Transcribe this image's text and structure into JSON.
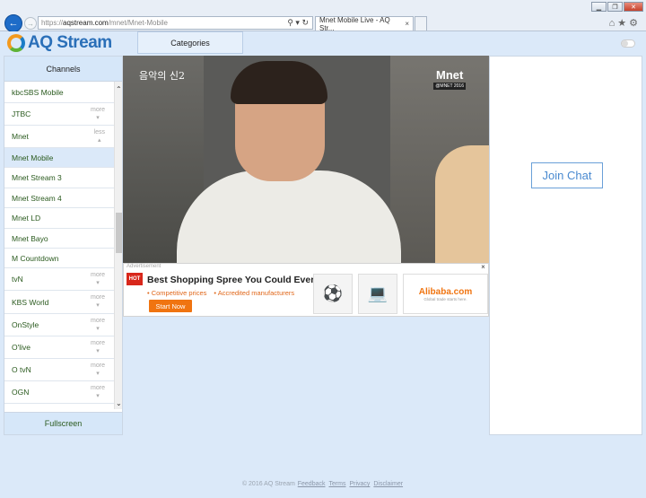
{
  "browser": {
    "url_prefix": "https://",
    "url_domain": "aqstream.com",
    "url_path": "/mnet/Mnet-Mobile",
    "tab_title": "Mnet Mobile Live - AQ Str...",
    "tab_close": "×"
  },
  "header": {
    "logo_text": "AQ Stream",
    "categories_label": "Categories"
  },
  "sidebar": {
    "title": "Channels",
    "fullscreen_label": "Fullscreen",
    "channels": [
      {
        "label": "kbcSBS Mobile",
        "toggle": "",
        "selected": false
      },
      {
        "label": "JTBC",
        "toggle": "more",
        "selected": false
      },
      {
        "label": "Mnet",
        "toggle": "less",
        "selected": false
      },
      {
        "label": "Mnet Mobile",
        "toggle": "",
        "selected": true
      },
      {
        "label": "Mnet Stream 3",
        "toggle": "",
        "selected": false
      },
      {
        "label": "Mnet Stream 4",
        "toggle": "",
        "selected": false
      },
      {
        "label": "Mnet LD",
        "toggle": "",
        "selected": false
      },
      {
        "label": "Mnet Bayo",
        "toggle": "",
        "selected": false
      },
      {
        "label": "M Countdown",
        "toggle": "",
        "selected": false
      },
      {
        "label": "tvN",
        "toggle": "more",
        "selected": false
      },
      {
        "label": "KBS World",
        "toggle": "more",
        "selected": false
      },
      {
        "label": "OnStyle",
        "toggle": "more",
        "selected": false
      },
      {
        "label": "O'live",
        "toggle": "more",
        "selected": false
      },
      {
        "label": "O tvN",
        "toggle": "more",
        "selected": false
      },
      {
        "label": "OGN",
        "toggle": "more",
        "selected": false
      }
    ]
  },
  "video": {
    "watermark": "음악의 신2",
    "logo": "Mnet",
    "logo_sub": "@MNET 2016"
  },
  "ad": {
    "label": "Advertisement",
    "close": "×",
    "hot": "HOT",
    "headline": "Best Shopping Spree You Could Ever Had",
    "bullet1": "• Competitive prices",
    "bullet2": "• Accredited manufacturers",
    "cta": "Start Now",
    "brand": "Alibaba.com",
    "brand_tagline": "Global trade starts here."
  },
  "chat": {
    "join_label": "Join Chat"
  },
  "footer": {
    "copyright": "© 2016 AQ Stream",
    "links": [
      "Feedback",
      "Terms",
      "Privacy",
      "Disclaimer"
    ]
  }
}
